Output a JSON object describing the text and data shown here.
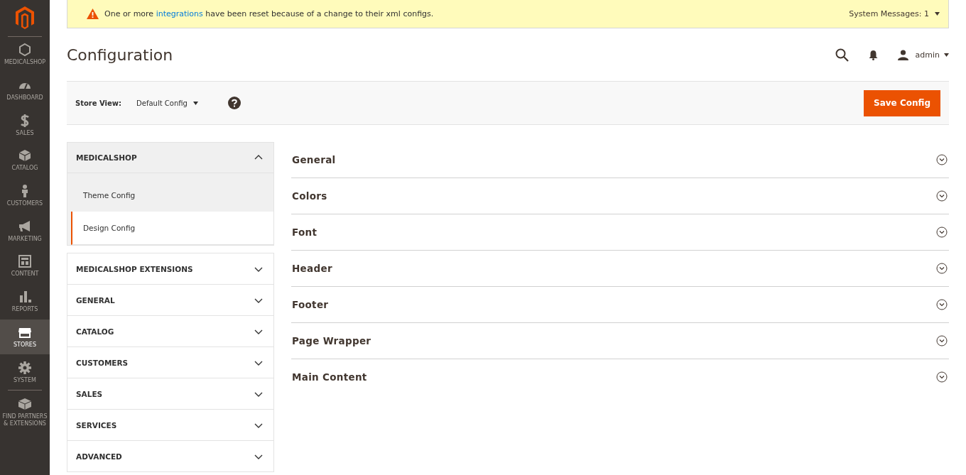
{
  "nav": [
    {
      "label": "MEDICALSHOP",
      "kind": "hexagon",
      "selected": false
    },
    {
      "label": "DASHBOARD",
      "kind": "dashboard",
      "selected": false
    },
    {
      "label": "SALES",
      "kind": "dollar",
      "selected": false
    },
    {
      "label": "CATALOG",
      "kind": "box",
      "selected": false
    },
    {
      "label": "CUSTOMERS",
      "kind": "person",
      "selected": false
    },
    {
      "label": "MARKETING",
      "kind": "megaphone",
      "selected": false
    },
    {
      "label": "CONTENT",
      "kind": "layout",
      "selected": false
    },
    {
      "label": "REPORTS",
      "kind": "bars",
      "selected": false
    },
    {
      "label": "STORES",
      "kind": "store",
      "selected": true
    },
    {
      "label": "SYSTEM",
      "kind": "gear",
      "selected": false
    },
    {
      "label": "FIND PARTNERS & EXTENSIONS",
      "kind": "blocks",
      "selected": false
    }
  ],
  "message": {
    "text_before": "One or more ",
    "link": "integrations",
    "text_after": " have been reset because of a change to their xml configs.",
    "counter": "System Messages: 1"
  },
  "page_title": "Configuration",
  "user": {
    "name": "admin"
  },
  "store_view": {
    "label": "Store View:",
    "value": "Default Config"
  },
  "save_button": "Save Config",
  "config_tabs": [
    {
      "title": "MEDICALSHOP",
      "expanded": true,
      "children": [
        {
          "label": "Theme Config",
          "selected": false
        },
        {
          "label": "Design Config",
          "selected": true
        }
      ]
    },
    {
      "title": "MEDICALSHOP EXTENSIONS",
      "expanded": false
    },
    {
      "title": "GENERAL",
      "expanded": false
    },
    {
      "title": "CATALOG",
      "expanded": false
    },
    {
      "title": "CUSTOMERS",
      "expanded": false
    },
    {
      "title": "SALES",
      "expanded": false
    },
    {
      "title": "SERVICES",
      "expanded": false
    },
    {
      "title": "ADVANCED",
      "expanded": false
    }
  ],
  "sections": [
    {
      "title": "General",
      "expanded": false
    },
    {
      "title": "Colors",
      "expanded": false
    },
    {
      "title": "Font",
      "expanded": false
    },
    {
      "title": "Header",
      "expanded": false
    },
    {
      "title": "Footer",
      "expanded": false
    },
    {
      "title": "Page Wrapper",
      "expanded": false
    },
    {
      "title": "Main Content",
      "expanded": false
    }
  ]
}
